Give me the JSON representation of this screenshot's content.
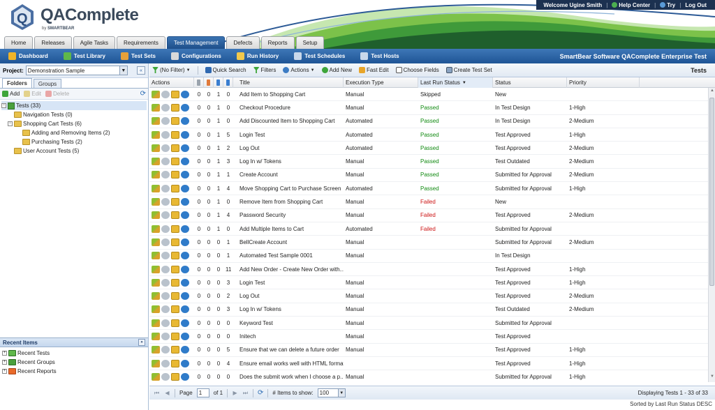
{
  "app": {
    "logo_name": "QAComplete",
    "logo_by": "by",
    "logo_brand": "SMARTBEAR"
  },
  "userbar": {
    "welcome": "Welcome Ugine Smith",
    "help": "Help Center",
    "try": "Try",
    "logout": "Log Out"
  },
  "tabs": [
    "Home",
    "Releases",
    "Agile Tasks",
    "Requirements",
    "Test Management",
    "Defects",
    "Reports",
    "Setup"
  ],
  "active_tab": "Test Management",
  "subnav": {
    "items": [
      {
        "label": "Dashboard",
        "icon": "dashboard-icon",
        "color": "#f0b429"
      },
      {
        "label": "Test Library",
        "icon": "test-library-icon",
        "color": "#5fb84a"
      },
      {
        "label": "Test Sets",
        "icon": "test-sets-icon",
        "color": "#e6a13a"
      },
      {
        "label": "Configurations",
        "icon": "configurations-icon",
        "color": "#d9d9d9"
      },
      {
        "label": "Run History",
        "icon": "run-history-icon",
        "color": "#f2c94c"
      },
      {
        "label": "Test Schedules",
        "icon": "test-schedules-icon",
        "color": "#c9d8ea"
      },
      {
        "label": "Test Hosts",
        "icon": "test-hosts-icon",
        "color": "#c9d8ea"
      }
    ],
    "brand": "SmartBear Software QAComplete Enterprise Test"
  },
  "project": {
    "label": "Project:",
    "value": "Demonstration Sample"
  },
  "panel_tabs": [
    "Folders",
    "Groups"
  ],
  "folder_tools": {
    "add": "Add",
    "edit": "Edit",
    "delete": "Delete"
  },
  "tree": {
    "root": "Tests (33)",
    "nav": "Navigation Tests (0)",
    "cart": "Shopping Cart Tests (6)",
    "adding": "Adding and Removing Items (2)",
    "purchasing": "Purchasing Tests (2)",
    "account": "User Account Tests (5)"
  },
  "recent": {
    "header": "Recent Items",
    "tests": "Recent Tests",
    "groups": "Recent Groups",
    "reports": "Recent Reports"
  },
  "toolbar": {
    "nofilter": "(No Filter)",
    "quicksearch": "Quick Search",
    "filters": "Filters",
    "actions": "Actions",
    "addnew": "Add New",
    "fastedit": "Fast Edit",
    "choosefields": "Choose Fields",
    "createtestset": "Create Test Set",
    "title": "Tests"
  },
  "columns": {
    "actions": "Actions",
    "title": "Title",
    "exec": "Execution Type",
    "last": "Last Run Status",
    "status": "Status",
    "priority": "Priority"
  },
  "rows": [
    {
      "n1": "0",
      "n2": "0",
      "n3": "1",
      "n4": "0",
      "title": "Add Item to Shopping Cart",
      "exec": "Manual",
      "last": "Skipped",
      "status": "New",
      "priority": ""
    },
    {
      "n1": "0",
      "n2": "0",
      "n3": "1",
      "n4": "0",
      "title": "Checkout Procedure",
      "exec": "Manual",
      "last": "Passed",
      "status": "In Test Design",
      "priority": "1-High"
    },
    {
      "n1": "0",
      "n2": "0",
      "n3": "1",
      "n4": "0",
      "title": "Add Discounted Item to Shopping Cart",
      "exec": "Automated",
      "last": "Passed",
      "status": "In Test Design",
      "priority": "2-Medium"
    },
    {
      "n1": "0",
      "n2": "0",
      "n3": "1",
      "n4": "5",
      "title": "Login Test",
      "exec": "Automated",
      "last": "Passed",
      "status": "Test Approved",
      "priority": "1-High"
    },
    {
      "n1": "0",
      "n2": "0",
      "n3": "1",
      "n4": "2",
      "title": "Log Out",
      "exec": "Automated",
      "last": "Passed",
      "status": "Test Approved",
      "priority": "2-Medium"
    },
    {
      "n1": "0",
      "n2": "0",
      "n3": "1",
      "n4": "3",
      "title": "Log In w/ Tokens",
      "exec": "Manual",
      "last": "Passed",
      "status": "Test Outdated",
      "priority": "2-Medium"
    },
    {
      "n1": "0",
      "n2": "0",
      "n3": "1",
      "n4": "1",
      "title": "Create Account",
      "exec": "Manual",
      "last": "Passed",
      "status": "Submitted for Approval",
      "priority": "2-Medium"
    },
    {
      "n1": "0",
      "n2": "0",
      "n3": "1",
      "n4": "4",
      "title": "Move Shopping Cart to Purchase Screen",
      "exec": "Automated",
      "last": "Passed",
      "status": "Submitted for Approval",
      "priority": "1-High"
    },
    {
      "n1": "0",
      "n2": "0",
      "n3": "1",
      "n4": "0",
      "title": "Remove Item from Shopping Cart",
      "exec": "Manual",
      "last": "Failed",
      "status": "New",
      "priority": ""
    },
    {
      "n1": "0",
      "n2": "0",
      "n3": "1",
      "n4": "4",
      "title": "Password Security",
      "exec": "Manual",
      "last": "Failed",
      "status": "Test Approved",
      "priority": "2-Medium"
    },
    {
      "n1": "0",
      "n2": "0",
      "n3": "1",
      "n4": "0",
      "title": "Add Multiple Items to Cart",
      "exec": "Automated",
      "last": "Failed",
      "status": "Submitted for Approval",
      "priority": ""
    },
    {
      "n1": "0",
      "n2": "0",
      "n3": "0",
      "n4": "1",
      "title": "BellCreate Account",
      "exec": "Manual",
      "last": "",
      "status": "Submitted for Approval",
      "priority": "2-Medium"
    },
    {
      "n1": "0",
      "n2": "0",
      "n3": "0",
      "n4": "1",
      "title": "Automated Test Sample 0001",
      "exec": "Manual",
      "last": "",
      "status": "In Test Design",
      "priority": ""
    },
    {
      "n1": "0",
      "n2": "0",
      "n3": "0",
      "n4": "11",
      "title": "Add New Order - Create New Order with...",
      "exec": "",
      "last": "",
      "status": "Test Approved",
      "priority": "1-High"
    },
    {
      "n1": "0",
      "n2": "0",
      "n3": "0",
      "n4": "3",
      "title": "Login Test",
      "exec": "Manual",
      "last": "",
      "status": "Test Approved",
      "priority": "1-High"
    },
    {
      "n1": "0",
      "n2": "0",
      "n3": "0",
      "n4": "2",
      "title": "Log Out",
      "exec": "Manual",
      "last": "",
      "status": "Test Approved",
      "priority": "2-Medium"
    },
    {
      "n1": "0",
      "n2": "0",
      "n3": "0",
      "n4": "3",
      "title": "Log In w/ Tokens",
      "exec": "Manual",
      "last": "",
      "status": "Test Outdated",
      "priority": "2-Medium"
    },
    {
      "n1": "0",
      "n2": "0",
      "n3": "0",
      "n4": "0",
      "title": "Keyword Test",
      "exec": "Manual",
      "last": "",
      "status": "Submitted for Approval",
      "priority": ""
    },
    {
      "n1": "0",
      "n2": "0",
      "n3": "0",
      "n4": "0",
      "title": "Initech",
      "exec": "Manual",
      "last": "",
      "status": "Test Approved",
      "priority": ""
    },
    {
      "n1": "0",
      "n2": "0",
      "n3": "0",
      "n4": "5",
      "title": "Ensure that we can delete a future order",
      "exec": "Manual",
      "last": "",
      "status": "Test Approved",
      "priority": "1-High"
    },
    {
      "n1": "0",
      "n2": "0",
      "n3": "0",
      "n4": "4",
      "title": "Ensure email works well with HTML format",
      "exec": "",
      "last": "",
      "status": "Test Approved",
      "priority": "1-High"
    },
    {
      "n1": "0",
      "n2": "0",
      "n3": "0",
      "n4": "0",
      "title": "Does the submit work when I choose a p...",
      "exec": "Manual",
      "last": "",
      "status": "Submitted for Approval",
      "priority": "1-High"
    }
  ],
  "pager": {
    "page_label": "Page",
    "page": "1",
    "of": "of 1",
    "items_label": "# Items to show:",
    "items": "100",
    "display": "Displaying Tests 1 - 33 of 33",
    "sorted": "Sorted by Last Run Status DESC"
  },
  "colors": {
    "passed": "#118a11",
    "failed": "#cc1111",
    "active_tab": "#1e4f8a",
    "subnav": "#2a63a5"
  }
}
